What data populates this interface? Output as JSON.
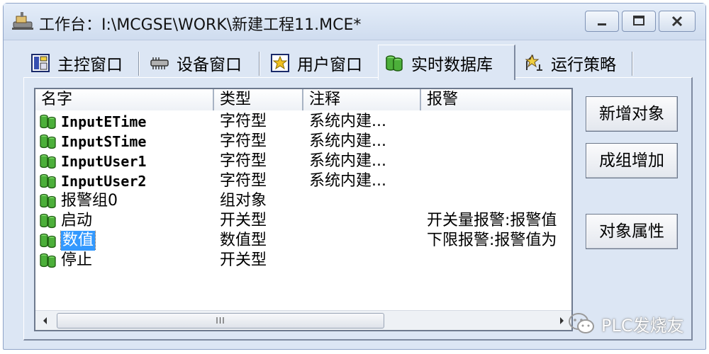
{
  "window": {
    "title": "工作台：I:\\MCGSE\\WORK\\新建工程11.MCE*",
    "icon": "workbench-icon"
  },
  "tabs": [
    {
      "label": "主控窗口",
      "icon": "main-window-icon"
    },
    {
      "label": "设备窗口",
      "icon": "device-icon"
    },
    {
      "label": "用户窗口",
      "icon": "user-window-icon"
    },
    {
      "label": "实时数据库",
      "icon": "database-icon",
      "active": true
    },
    {
      "label": "运行策略",
      "icon": "strategy-icon"
    }
  ],
  "list": {
    "columns": [
      "名字",
      "类型",
      "注释",
      "报警"
    ],
    "rows": [
      {
        "name": "InputETime",
        "type": "字符型",
        "note": "系统内建...",
        "alarm": ""
      },
      {
        "name": "InputSTime",
        "type": "字符型",
        "note": "系统内建...",
        "alarm": ""
      },
      {
        "name": "InputUser1",
        "type": "字符型",
        "note": "系统内建...",
        "alarm": ""
      },
      {
        "name": "InputUser2",
        "type": "字符型",
        "note": "系统内建...",
        "alarm": ""
      },
      {
        "name": "报警组0",
        "type": "组对象",
        "note": "",
        "alarm": ""
      },
      {
        "name": "启动",
        "type": "开关型",
        "note": "",
        "alarm": "开关量报警:报警值"
      },
      {
        "name": "数值",
        "type": "数值型",
        "note": "",
        "alarm": "下限报警:报警值为",
        "selected": true
      },
      {
        "name": "停止",
        "type": "开关型",
        "note": "",
        "alarm": ""
      }
    ],
    "scrollbar_thumb_label": "III"
  },
  "buttons": {
    "add_object": "新增对象",
    "group_add": "成组增加",
    "object_properties": "对象属性"
  },
  "watermark": "PLC发烧友",
  "colors": {
    "selection": "#3399ff",
    "window_bg": "#dce6f4"
  }
}
